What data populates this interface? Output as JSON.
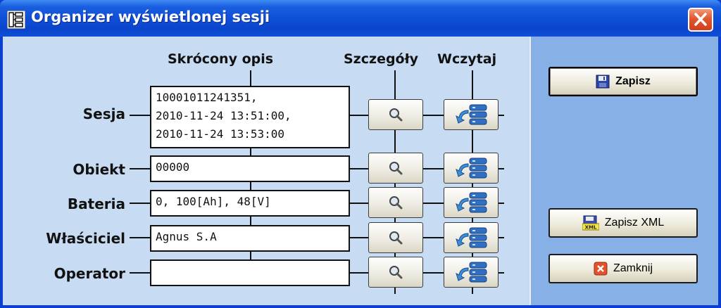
{
  "window": {
    "title": "Organizer wyświetlonej sesji"
  },
  "headers": {
    "short_desc": "Skrócony opis",
    "details": "Szczegóły",
    "load": "Wczytaj"
  },
  "rows": [
    {
      "label": "Sesja",
      "value": "10001011241351,\n2010-11-24 13:51:00,\n2010-11-24 13:53:00"
    },
    {
      "label": "Obiekt",
      "value": "00000"
    },
    {
      "label": "Bateria",
      "value": "0, 100[Ah], 48[V]"
    },
    {
      "label": "Właściciel",
      "value": "Agnus S.A"
    },
    {
      "label": "Operator",
      "value": ""
    }
  ],
  "buttons": {
    "save": "Zapisz",
    "save_xml": "Zapisz XML",
    "close": "Zamknij"
  },
  "icons": {
    "details": "magnifier-icon",
    "load": "load-from-db-icon",
    "save": "floppy-disk-icon",
    "save_xml": "xml-floppy-icon",
    "close": "red-x-icon"
  },
  "colors": {
    "titlebar": "#0a45cc",
    "left_panel": "#c7dcf2",
    "right_panel": "#86b0e6",
    "close_button": "#d23f1c"
  }
}
